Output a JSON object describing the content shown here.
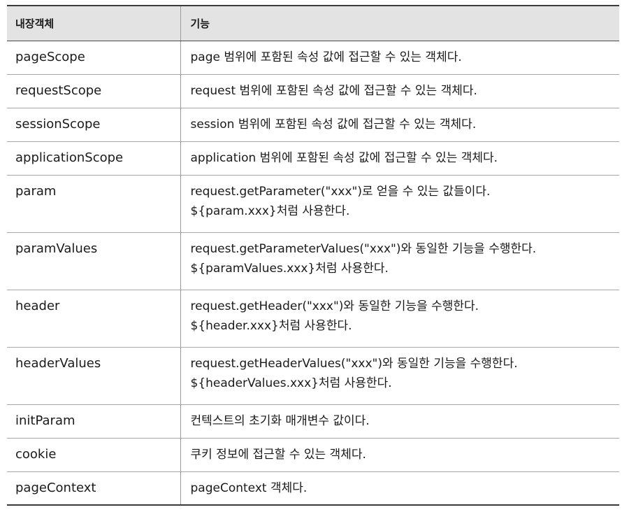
{
  "table": {
    "headers": [
      "내장객체",
      "기능"
    ],
    "rows": [
      {
        "name": "pageScope",
        "desc": [
          "page 범위에 포함된 속성 값에 접근할 수 있는 객체다."
        ]
      },
      {
        "name": "requestScope",
        "desc": [
          "request 범위에 포함된 속성 값에 접근할 수 있는 객체다."
        ]
      },
      {
        "name": "sessionScope",
        "desc": [
          "session 범위에 포함된 속성 값에 접근할 수 있는 객체다."
        ]
      },
      {
        "name": "applicationScope",
        "desc": [
          "application 범위에 포함된 속성 값에 접근할 수 있는 객체다."
        ]
      },
      {
        "name": "param",
        "desc": [
          "request.getParameter(\"xxx\")로 얻을 수 있는 값들이다.",
          "${param.xxx}처럼 사용한다."
        ]
      },
      {
        "name": "paramValues",
        "desc": [
          "request.getParameterValues(\"xxx\")와 동일한 기능을 수행한다.",
          "${paramValues.xxx}처럼 사용한다."
        ]
      },
      {
        "name": "header",
        "desc": [
          "request.getHeader(\"xxx\")와 동일한 기능을 수행한다.",
          "${header.xxx}처럼 사용한다."
        ]
      },
      {
        "name": "headerValues",
        "desc": [
          "request.getHeaderValues(\"xxx\")와 동일한 기능을 수행한다.",
          "${headerValues.xxx}처럼 사용한다."
        ]
      },
      {
        "name": "initParam",
        "desc": [
          "컨텍스트의 초기화 매개변수 값이다."
        ]
      },
      {
        "name": "cookie",
        "desc": [
          "쿠키 정보에 접근할 수 있는 객체다."
        ]
      },
      {
        "name": "pageContext",
        "desc": [
          "pageContext 객체다."
        ]
      }
    ]
  }
}
